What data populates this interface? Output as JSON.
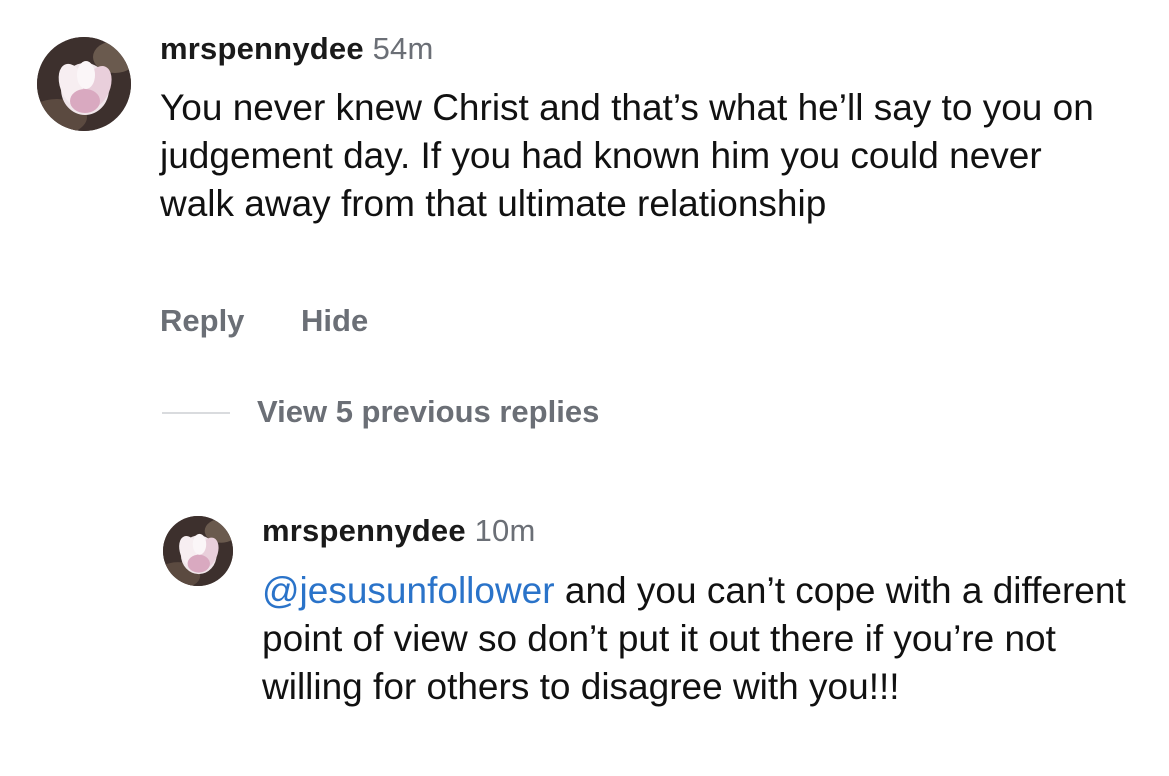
{
  "comment": {
    "username": "mrspennydee",
    "time": "54m",
    "text": "You never knew Christ and that’s what he’ll say to you on judgement day. If you had known him you could never walk away from that ultimate relationship",
    "actions": {
      "reply_label": "Reply",
      "hide_label": "Hide"
    },
    "view_replies_label": "View 5 previous replies"
  },
  "reply": {
    "username": "mrspennydee",
    "time": "10m",
    "mention": "@jesusunfollower",
    "text": " and you can’t cope with a different point of view so don’t put it out there if you’re not willing for others to disagree with you!!!"
  },
  "colors": {
    "secondary_text": "#6b6f76",
    "mention": "#2a73c9",
    "divider": "#d9dbde"
  },
  "icons": {
    "avatar": "magnolia-flower-avatar"
  }
}
